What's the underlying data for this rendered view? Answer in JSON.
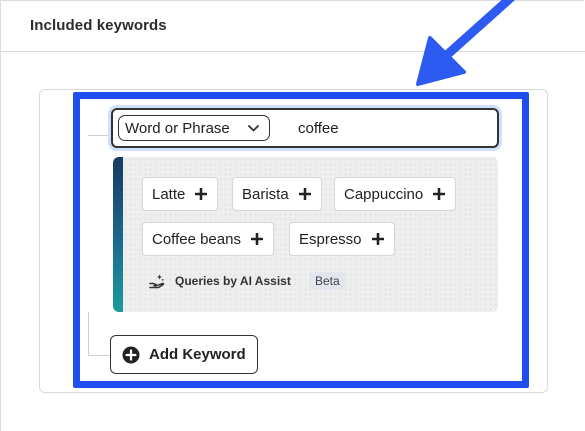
{
  "section": {
    "title": "Included keywords"
  },
  "query_row": {
    "type_select": {
      "selected": "Word or Phrase",
      "icon": "chevron-down-icon"
    },
    "value": "coffee"
  },
  "suggestions": {
    "chips": [
      {
        "label": "Latte",
        "icon": "plus-icon"
      },
      {
        "label": "Barista",
        "icon": "plus-icon"
      },
      {
        "label": "Cappuccino",
        "icon": "plus-icon"
      },
      {
        "label": "Coffee beans",
        "icon": "plus-icon"
      },
      {
        "label": "Espresso",
        "icon": "plus-icon"
      }
    ],
    "ai_assist": {
      "icon": "ai-assist-hand-icon",
      "label": "Queries by AI Assist",
      "badge": "Beta"
    }
  },
  "add_keyword": {
    "label": "Add Keyword",
    "icon": "plus-circle-icon"
  },
  "colors": {
    "highlight_border": "#1f4ff0",
    "annotation_arrow": "#2d5bf1",
    "suggestion_bar_top": "#173a63",
    "suggestion_bar_bottom": "#1d9a9c",
    "focus_ring": "#cfe0fb"
  }
}
